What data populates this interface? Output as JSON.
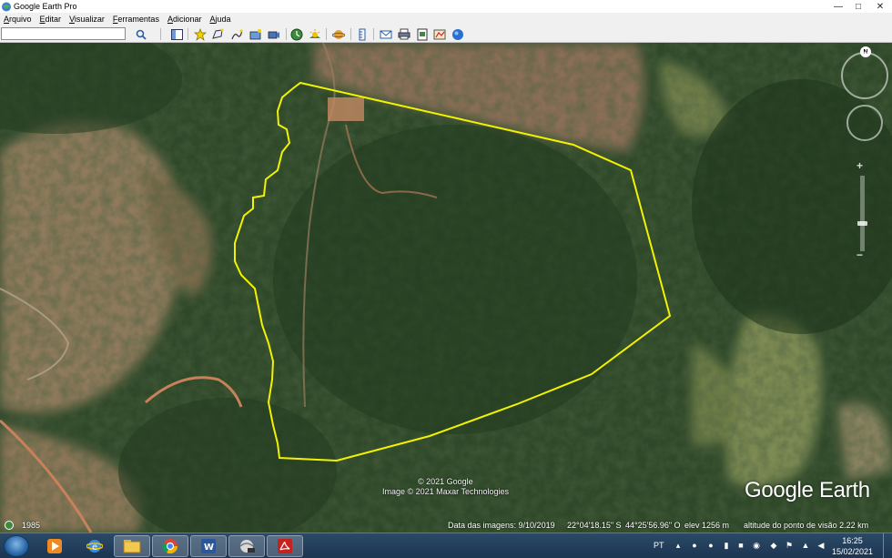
{
  "window": {
    "title": "Google Earth Pro",
    "minimize_glyph": "—",
    "maximize_glyph": "□",
    "close_glyph": "✕"
  },
  "menu": [
    {
      "label": "Arquivo",
      "accel": "A",
      "rest": "rquivo"
    },
    {
      "label": "Editar",
      "accel": "E",
      "rest": "ditar"
    },
    {
      "label": "Visualizar",
      "accel": "V",
      "rest": "isualizar"
    },
    {
      "label": "Ferramentas",
      "accel": "F",
      "rest": "erramentas"
    },
    {
      "label": "Adicionar",
      "accel": "A",
      "rest": "dicionar"
    },
    {
      "label": "Ajuda",
      "accel": "A",
      "rest": "juda"
    }
  ],
  "search": {
    "value": "",
    "placeholder": ""
  },
  "toolbar_icons": [
    "search-icon",
    "sidebar-icon",
    "placemark-icon",
    "polygon-icon",
    "path-icon",
    "image-overlay-icon",
    "record-tour-icon",
    "historical-imagery-icon",
    "sunlight-icon",
    "planet-icon",
    "ruler-icon",
    "email-icon",
    "print-icon",
    "save-image-icon",
    "view-maps-icon",
    "sign-in-icon"
  ],
  "map": {
    "copyright_line1": "© 2021 Google",
    "copyright_line2": "Image © 2021 Maxar Technologies",
    "logo": "Google Earth",
    "north_label": "N",
    "zoom_plus": "+",
    "zoom_minus": "−"
  },
  "status": {
    "historical_year": "1985",
    "imagery_date": "Data das imagens: 9/10/2019",
    "latitude": "22°04'18.15\" S",
    "longitude": "44°25'56.96\" O",
    "elevation": "elev  1256 m",
    "eye_altitude": "altitude do ponto de visão   2.22 km"
  },
  "taskbar": {
    "apps": [
      "media-player-icon",
      "internet-explorer-icon",
      "file-explorer-icon",
      "chrome-icon",
      "word-icon",
      "google-earth-pro-icon",
      "acrobat-icon"
    ],
    "language": "PT",
    "time": "16:25",
    "date": "15/02/2021"
  },
  "colors": {
    "polygon": "#f2f200",
    "forest": "#2f4a29",
    "pasture": "#8e7a5e",
    "road": "#c27a52",
    "taskbar": "#1f3a57"
  }
}
